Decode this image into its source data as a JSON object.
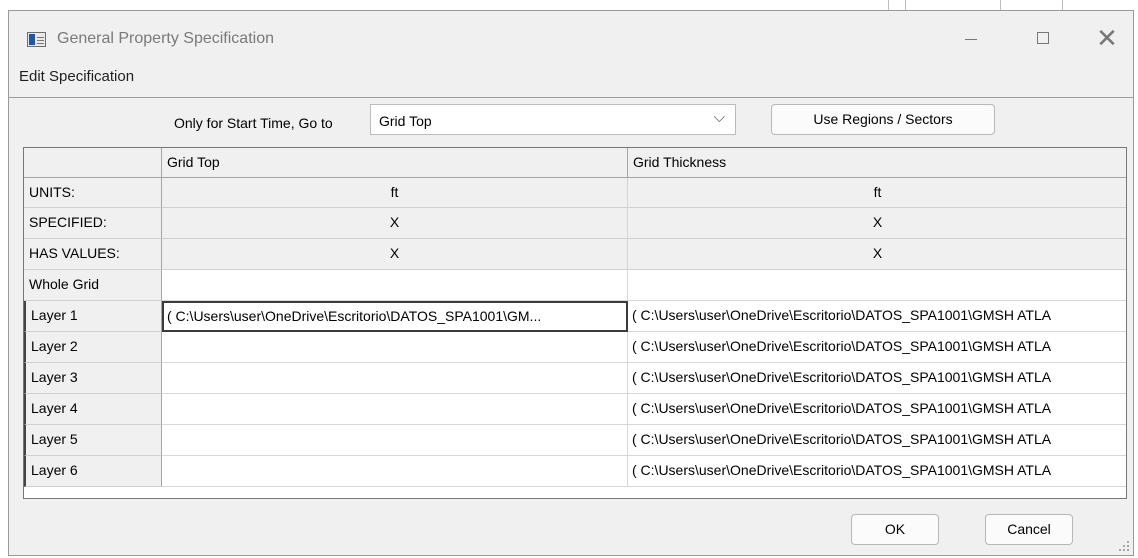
{
  "window": {
    "title": "General Property Specification",
    "controls": {
      "minimize": "—",
      "maximize": "□",
      "close": "✕"
    }
  },
  "menu": {
    "edit_specification": "Edit Specification"
  },
  "toolbar": {
    "goto_label": "Only for Start Time, Go to",
    "goto_select": {
      "value": "Grid Top",
      "chevron": "⌵"
    },
    "regions_button": "Use Regions / Sectors"
  },
  "grid": {
    "columns": [
      "Grid Top",
      "Grid Thickness"
    ],
    "meta_rows": [
      {
        "label": "UNITS:",
        "values": [
          "ft",
          "ft"
        ]
      },
      {
        "label": "SPECIFIED:",
        "values": [
          "X",
          "X"
        ]
      },
      {
        "label": "HAS VALUES:",
        "values": [
          "X",
          "X"
        ]
      }
    ],
    "data_rows": [
      {
        "label": "Whole Grid",
        "values": [
          "",
          ""
        ]
      },
      {
        "label": "Layer 1",
        "values": [
          "( C:\\Users\\user\\OneDrive\\Escritorio\\DATOS_SPA1001\\GM...",
          "( C:\\Users\\user\\OneDrive\\Escritorio\\DATOS_SPA1001\\GMSH ATLA"
        ]
      },
      {
        "label": "Layer 2",
        "values": [
          "",
          "( C:\\Users\\user\\OneDrive\\Escritorio\\DATOS_SPA1001\\GMSH ATLA"
        ]
      },
      {
        "label": "Layer 3",
        "values": [
          "",
          "( C:\\Users\\user\\OneDrive\\Escritorio\\DATOS_SPA1001\\GMSH ATLA"
        ]
      },
      {
        "label": "Layer 4",
        "values": [
          "",
          "( C:\\Users\\user\\OneDrive\\Escritorio\\DATOS_SPA1001\\GMSH ATLA"
        ]
      },
      {
        "label": "Layer 5",
        "values": [
          "",
          "( C:\\Users\\user\\OneDrive\\Escritorio\\DATOS_SPA1001\\GMSH ATLA"
        ]
      },
      {
        "label": "Layer 6",
        "values": [
          "",
          "( C:\\Users\\user\\OneDrive\\Escritorio\\DATOS_SPA1001\\GMSH ATLA"
        ]
      }
    ]
  },
  "buttons": {
    "ok": "OK",
    "cancel": "Cancel"
  }
}
